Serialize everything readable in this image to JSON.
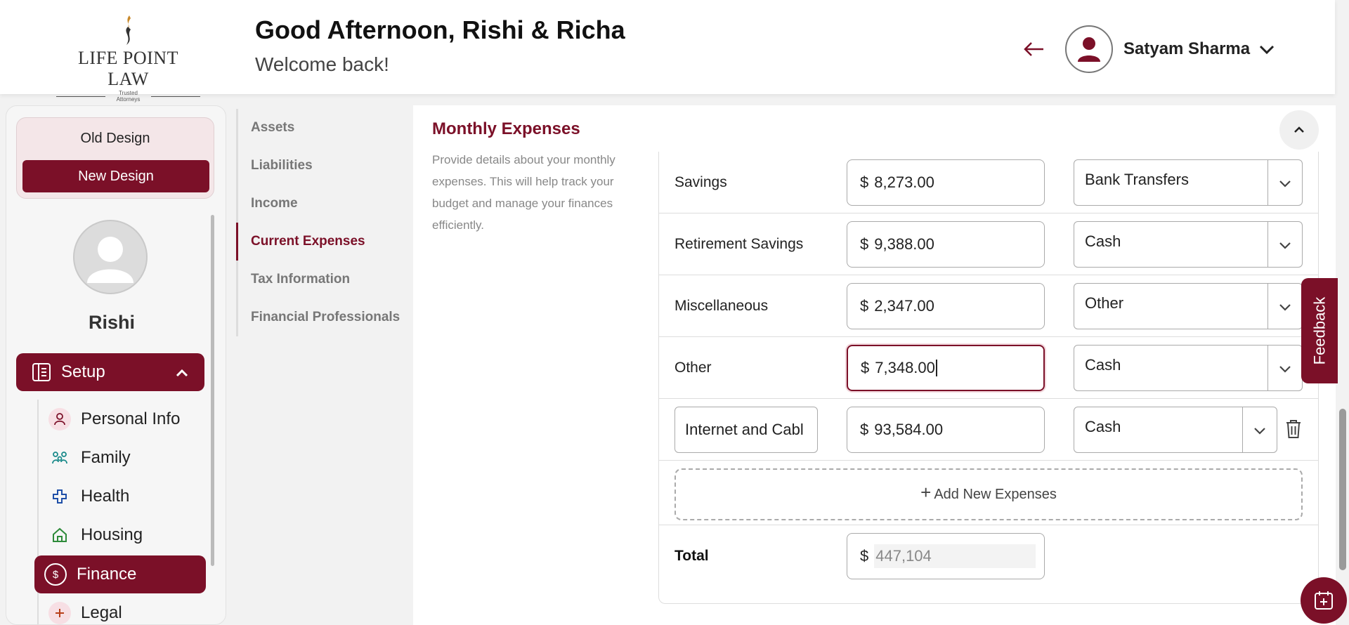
{
  "header": {
    "logo_text": "LIFE POINT LAW",
    "logo_tagline": "Trusted Attorneys",
    "greeting": "Good Afternoon, Rishi & Richa",
    "welcome": "Welcome back!",
    "user_name": "Satyam Sharma"
  },
  "sidebar": {
    "old_design": "Old Design",
    "new_design": "New Design",
    "profile_name": "Rishi",
    "setup_label": "Setup",
    "items": [
      {
        "label": "Personal Info",
        "icon": "person-icon"
      },
      {
        "label": "Family",
        "icon": "family-icon"
      },
      {
        "label": "Health",
        "icon": "health-cross-icon"
      },
      {
        "label": "Housing",
        "icon": "house-icon"
      },
      {
        "label": "Finance",
        "icon": "dollar-icon",
        "active": true
      },
      {
        "label": "Legal",
        "icon": "legal-icon"
      }
    ]
  },
  "subnav": {
    "items": [
      "Assets",
      "Liabilities",
      "Income",
      "Current Expenses",
      "Tax Information",
      "Financial Professionals"
    ],
    "active": "Current Expenses"
  },
  "section": {
    "title": "Monthly Expenses",
    "description": "Provide details about your monthly expenses. This will help track your budget and manage your finances efficiently."
  },
  "expenses": {
    "currency": "$",
    "rows": [
      {
        "label": "Savings",
        "amount": "8,273.00",
        "method": "Bank Transfers"
      },
      {
        "label": "Retirement Savings",
        "amount": "9,388.00",
        "method": "Cash"
      },
      {
        "label": "Miscellaneous",
        "amount": "2,347.00",
        "method": "Other"
      },
      {
        "label": "Other",
        "amount": "7,348.00",
        "method": "Cash"
      },
      {
        "label": "Internet and Cabl",
        "amount": "93,584.00",
        "method": "Cash"
      }
    ],
    "add_label": "Add New Expenses",
    "total_label": "Total",
    "total_value": "447,104"
  },
  "feedback_label": "Feedback",
  "colors": {
    "brand": "#7b1028",
    "accent_gold": "#c8892a"
  }
}
